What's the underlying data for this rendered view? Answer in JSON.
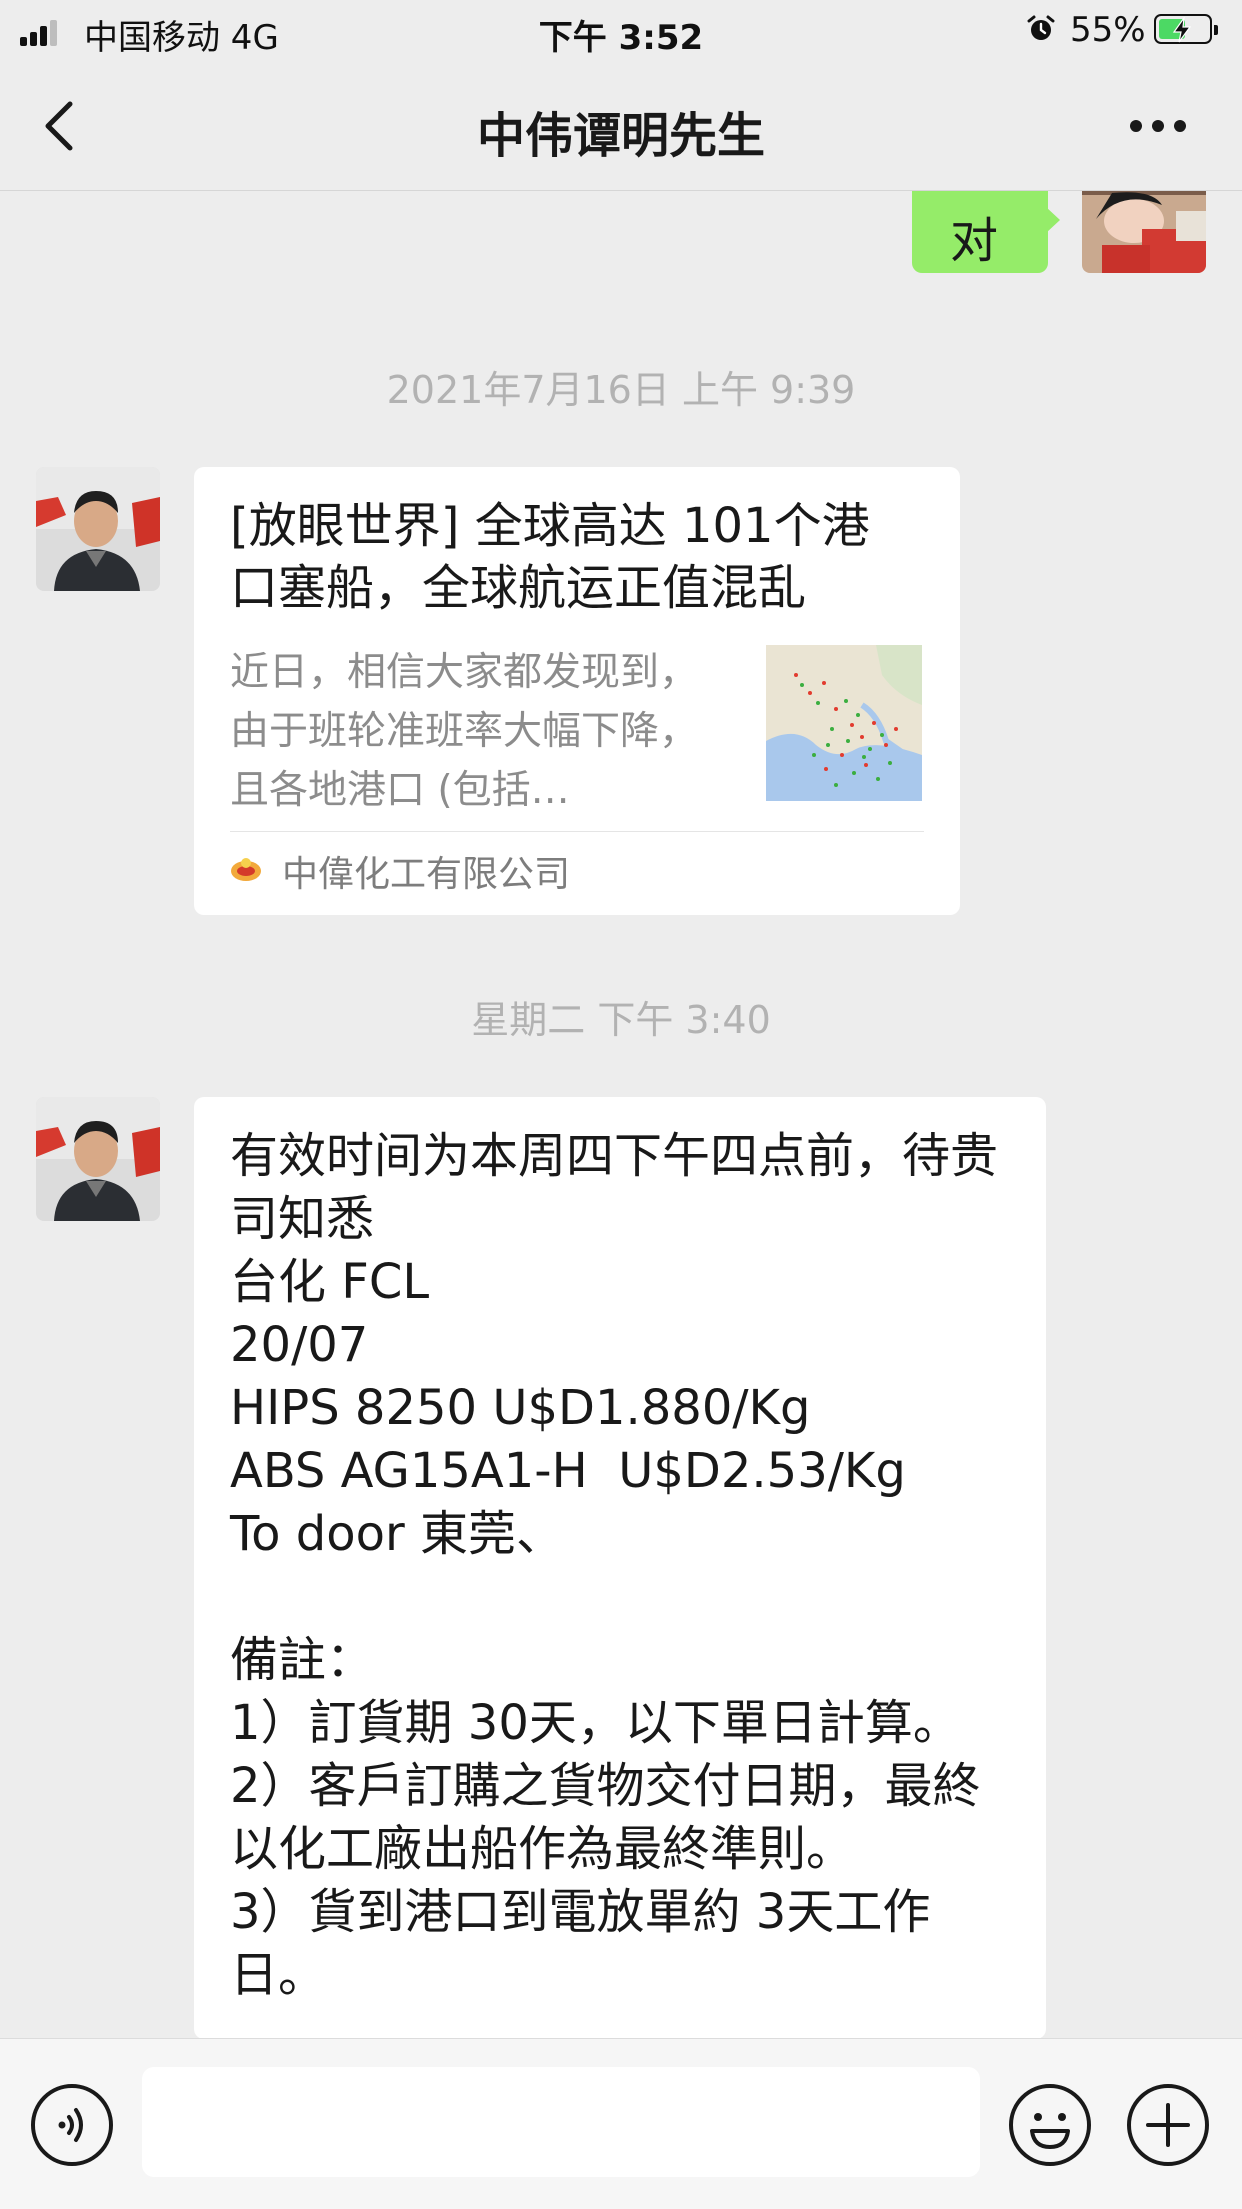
{
  "status_bar": {
    "carrier": "中国移动   4G",
    "time": "下午 3:52",
    "battery": "55%",
    "battery_level": 0.55
  },
  "nav": {
    "title": "中伟谭明先生"
  },
  "messages": {
    "sent_reply": "对",
    "time_1": "2021年7月16日 上午 9:39",
    "article": {
      "title": "[放眼世界] 全球高达 101个港口塞船，全球航运正值混乱",
      "desc": "近日，相信大家都发现到，由于班轮准班率大幅下降，且各地港口 (包括…",
      "source": "中偉化工有限公司"
    },
    "time_2": "星期二 下午 3:40",
    "text_message": "有效时间为本周四下午四点前，待贵司知悉\n台化 FCL\n20/07\nHIPS 8250 U$D1.880/Kg\nABS AG15A1-H  U$D2.53/Kg\nTo door 東莞、\n\n備註：\n1）訂貨期 30天，以下單日計算。\n2）客戶訂購之貨物交付日期，最終以化工廠出船作為最終準則。\n3）貨到港口到電放單約 3天工作日。"
  },
  "input": {
    "value": ""
  },
  "colors": {
    "background": "#ededed",
    "sent_bubble": "#95ec69",
    "received_bubble": "#ffffff",
    "timestamp": "#b2b2b2"
  }
}
